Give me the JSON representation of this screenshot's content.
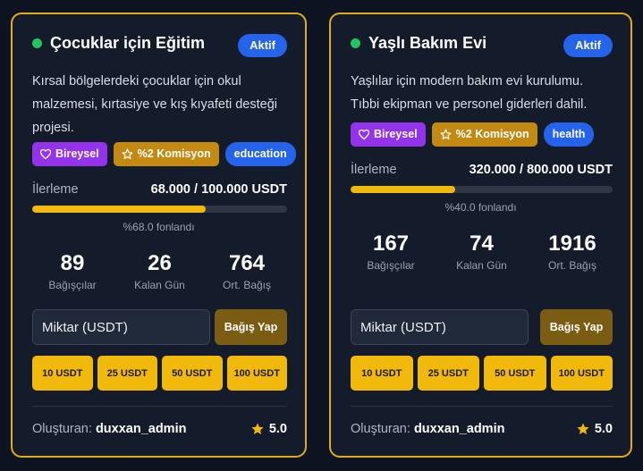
{
  "campaigns": [
    {
      "title": "Çocuklar için Eğitim",
      "status": "Aktif",
      "status_color": "#22c55e",
      "description": "Kırsal bölgelerdeki çocuklar için okul malzemesi, kırtasiye ve kış kıyafeti desteği projesi.",
      "tags": {
        "personal": "Bireysel",
        "commission": "%2 Komisyon",
        "category": "education"
      },
      "progress": {
        "label": "İlerleme",
        "amount": "68.000 / 100.000 USDT",
        "percent_text": "%68.0 fonlandı",
        "fraction": 0.68
      },
      "stats": [
        {
          "value": "89",
          "label": "Bağışçılar"
        },
        {
          "value": "26",
          "label": "Kalan Gün"
        },
        {
          "value": "764",
          "label": "Ort. Bağış"
        }
      ],
      "amount_placeholder": "Miktar (USDT)",
      "donate_label": "Bağış Yap",
      "quick_amounts": [
        "10 USDT",
        "25 USDT",
        "50 USDT",
        "100 USDT"
      ],
      "creator_label": "Oluşturan:",
      "creator_name": "duxxan_admin",
      "rating": "5.0"
    },
    {
      "title": "Yaşlı Bakım Evi",
      "status": "Aktif",
      "status_color": "#22c55e",
      "description": "Yaşlılar için modern bakım evi kurulumu. Tıbbi ekipman ve personel giderleri dahil.",
      "tags": {
        "personal": "Bireysel",
        "commission": "%2 Komisyon",
        "category": "health"
      },
      "progress": {
        "label": "İlerleme",
        "amount": "320.000 / 800.000 USDT",
        "percent_text": "%40.0 fonlandı",
        "fraction": 0.4
      },
      "stats": [
        {
          "value": "167",
          "label": "Bağışçılar"
        },
        {
          "value": "74",
          "label": "Kalan Gün"
        },
        {
          "value": "1916",
          "label": "Ort. Bağış"
        }
      ],
      "amount_placeholder": "Miktar (USDT)",
      "donate_label": "Bağış Yap",
      "quick_amounts": [
        "10 USDT",
        "25 USDT",
        "50 USDT",
        "100 USDT"
      ],
      "creator_label": "Oluşturan:",
      "creator_name": "duxxan_admin",
      "rating": "5.0"
    }
  ],
  "colors": {
    "accent": "#f0b90b",
    "card_border": "#e0ac18",
    "status_badge": "#2563eb",
    "personal_tag": "#9333ea",
    "commission_tag": "#c28a12",
    "category_tag": "#2563eb",
    "donate_button": "#7a5d12"
  },
  "icons": {
    "personal_tag": "heart-icon",
    "commission_tag": "star-outline-icon",
    "rating": "star-icon"
  }
}
